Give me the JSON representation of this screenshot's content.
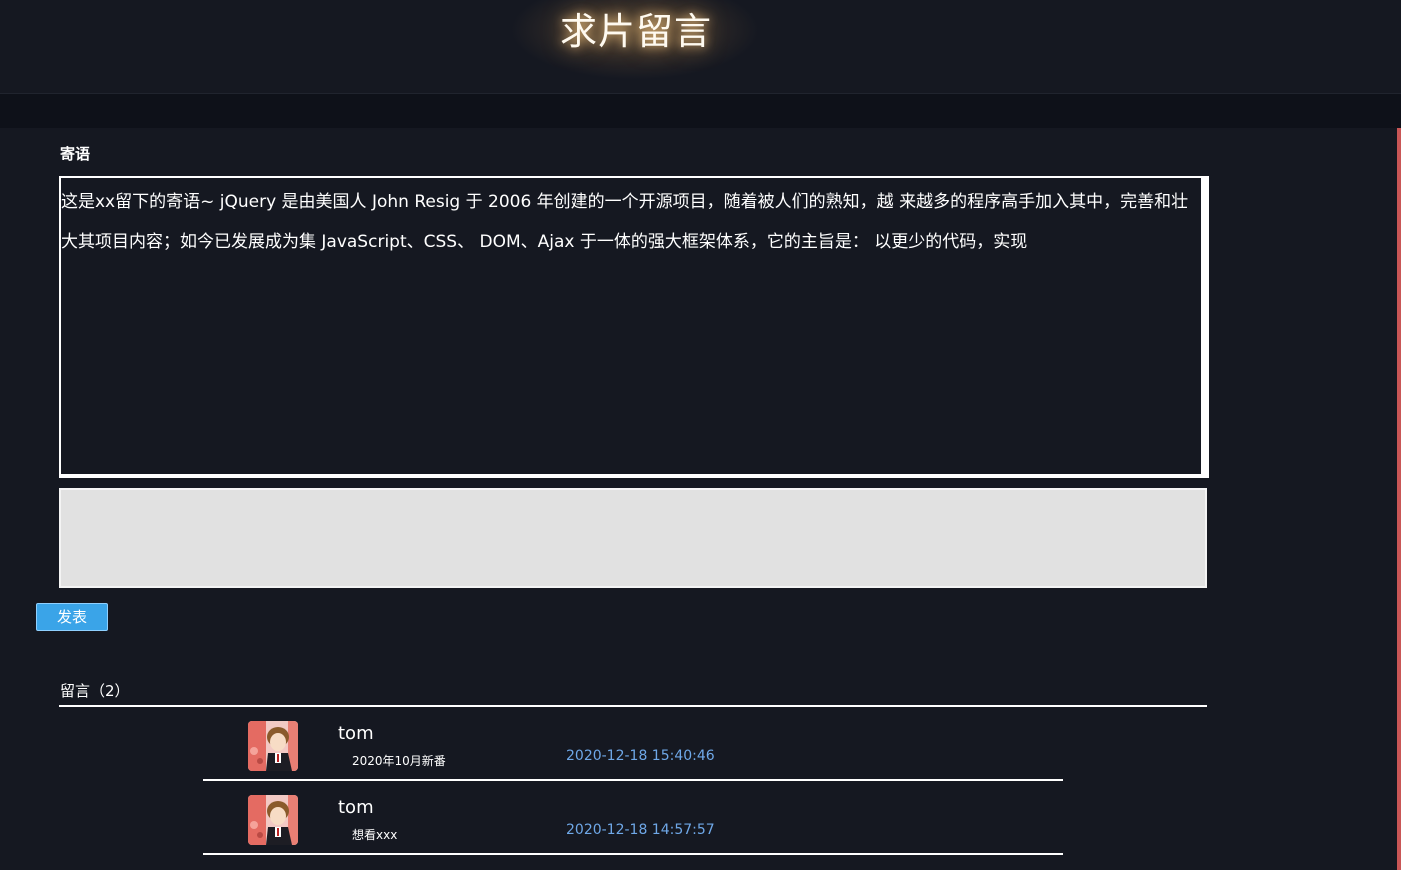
{
  "header": {
    "title": "求片留言"
  },
  "compose": {
    "label": "寄语",
    "message": "这是xx留下的寄语~ jQuery 是由美国人 John Resig 于 2006 年创建的一个开源项目，随着被人们的熟知，越 来越多的程序高手加入其中，完善和壮大其项目内容；如今已发展成为集 JavaScript、CSS、 DOM、Ajax 于一体的强大框架体系，它的主旨是： 以更少的代码，实现",
    "input_value": "",
    "publish_label": "发表"
  },
  "comments": {
    "header": "留言（2）",
    "items": [
      {
        "name": "tom",
        "text": "2020年10月新番",
        "time": "2020-12-18 15:40:46"
      },
      {
        "name": "tom",
        "text": "想看xxx",
        "time": "2020-12-18 14:57:57"
      }
    ]
  },
  "colors": {
    "background": "#151821",
    "accent_blue": "#3aa4e8",
    "timestamp": "#6fa8e8",
    "right_accent": "#c95656"
  },
  "icons": {
    "avatar": "anime-avatar-image"
  }
}
